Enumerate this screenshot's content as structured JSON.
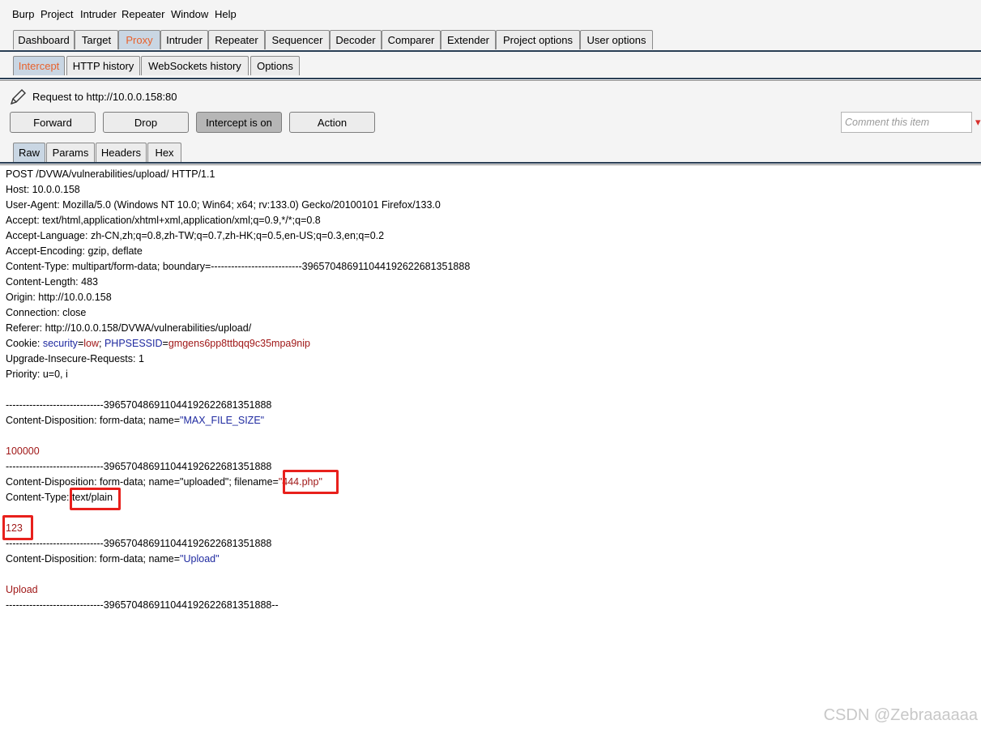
{
  "menu": [
    "Burp",
    "Project",
    "Intruder",
    "Repeater",
    "Window",
    "Help"
  ],
  "main_tabs": [
    "Dashboard",
    "Target",
    "Proxy",
    "Intruder",
    "Repeater",
    "Sequencer",
    "Decoder",
    "Comparer",
    "Extender",
    "Project options",
    "User options"
  ],
  "main_active": "Proxy",
  "proxy_tabs": [
    "Intercept",
    "HTTP history",
    "WebSockets history",
    "Options"
  ],
  "proxy_active": "Intercept",
  "request_to": "Request to http://10.0.0.158:80",
  "buttons": {
    "forward": "Forward",
    "drop": "Drop",
    "intercept": "Intercept is on",
    "action": "Action"
  },
  "comment_placeholder": "Comment this item",
  "editor_tabs": [
    "Raw",
    "Params",
    "Headers",
    "Hex"
  ],
  "editor_active": "Raw",
  "request": {
    "l1": "POST /DVWA/vulnerabilities/upload/ HTTP/1.1",
    "l2": "Host: 10.0.0.158",
    "l3": "User-Agent: Mozilla/5.0 (Windows NT 10.0; Win64; x64; rv:133.0) Gecko/20100101 Firefox/133.0",
    "l4": "Accept: text/html,application/xhtml+xml,application/xml;q=0.9,*/*;q=0.8",
    "l5": "Accept-Language: zh-CN,zh;q=0.8,zh-TW;q=0.7,zh-HK;q=0.5,en-US;q=0.3,en;q=0.2",
    "l6": "Accept-Encoding: gzip, deflate",
    "l7": "Content-Type: multipart/form-data; boundary=---------------------------39657048691104419262268135188​8",
    "l8": "Content-Length: 483",
    "l9": "Origin: http://10.0.0.158",
    "l10": "Connection: close",
    "l11": "Referer: http://10.0.0.158/DVWA/vulnerabilities/upload/",
    "cookie_prefix": "Cookie: ",
    "cookie_k1": "security",
    "cookie_eq1": "=",
    "cookie_v1": "low",
    "cookie_sep": "; ",
    "cookie_k2": "PHPSESSID",
    "cookie_eq2": "=",
    "cookie_v2": "gmgens6pp8ttbqq9c35mpa9nip",
    "l13": "Upgrade-Insecure-Requests: 1",
    "l14": "Priority: u=0, i",
    "boundary": "-----------------------------396570486911044192622681351888",
    "cd_prefix": "Content-Disposition: form-data; name=",
    "name1": "\"MAX_FILE_SIZE\"",
    "value1": "100000",
    "cd2_prefix": "Content-Disposition: form-data; name=\"uploaded\"; filename=",
    "filename": "\"444.php\"",
    "ct_prefix": "Content-Type: ",
    "ct_value": "text/plain",
    "value2": "123",
    "name3": "\"Upload\"",
    "value3": "Upload",
    "boundary_end": "-----------------------------396570486911044192622681351888--"
  },
  "watermark": "CSDN @Zebraaaaaa"
}
